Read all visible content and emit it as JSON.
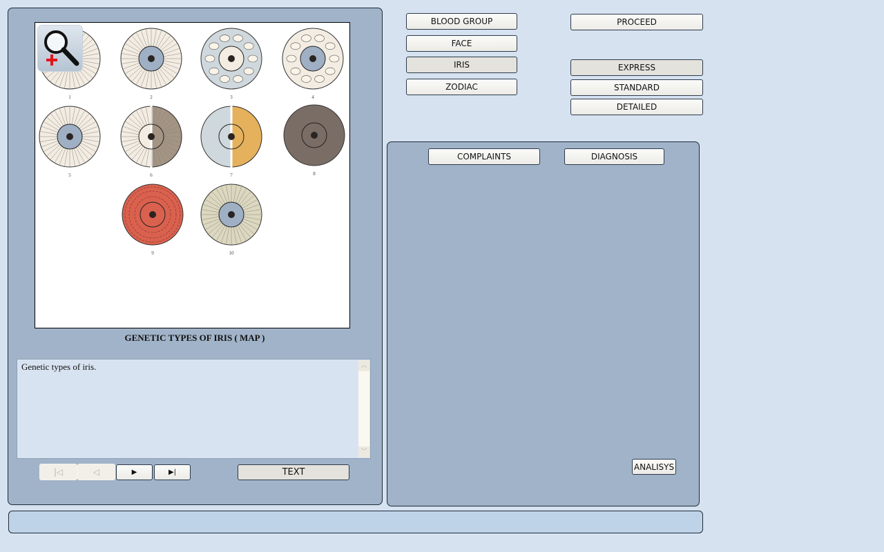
{
  "left_panel": {
    "image_caption": "GENETIC TYPES OF IRIS ( MAP )",
    "zoom_button": {
      "icon": "magnifier-plus-icon"
    },
    "iris_labels": [
      "1",
      "2",
      "3",
      "4",
      "5",
      "6",
      "7",
      "8",
      "9",
      "10"
    ],
    "iris_colors": {
      "light": "#f3ece2",
      "blue": "#9fb0c4",
      "brown": "#a49484",
      "dark_brown": "#7a6d66",
      "orange": "#e6b15c",
      "pale_blue": "#cfd8dc",
      "red": "#d9614e",
      "olive": "#dcd8c0"
    },
    "description_text": "Genetic types of iris.",
    "nav": {
      "first_icon": "first-page-icon",
      "prev_icon": "prev-page-icon",
      "play_icon": "play-icon",
      "last_icon": "last-page-icon",
      "first_glyph": "|◁",
      "prev_glyph": "◁",
      "play_glyph": "▶",
      "last_glyph": "▶|"
    },
    "text_button": "TEXT"
  },
  "categories": {
    "blood_group": "BLOOD GROUP",
    "face": "FACE",
    "iris": "IRIS",
    "zodiac": "ZODIAC",
    "selected": "IRIS"
  },
  "modes": {
    "proceed": "PROCEED",
    "express": "EXPRESS",
    "standard": "STANDARD",
    "detailed": "DETAILED",
    "selected": "EXPRESS"
  },
  "right_panel": {
    "complaints": "COMPLAINTS",
    "diagnosis": "DIAGNOSIS",
    "analysis": "ANALISYS"
  },
  "status_bar": {
    "text": ""
  }
}
